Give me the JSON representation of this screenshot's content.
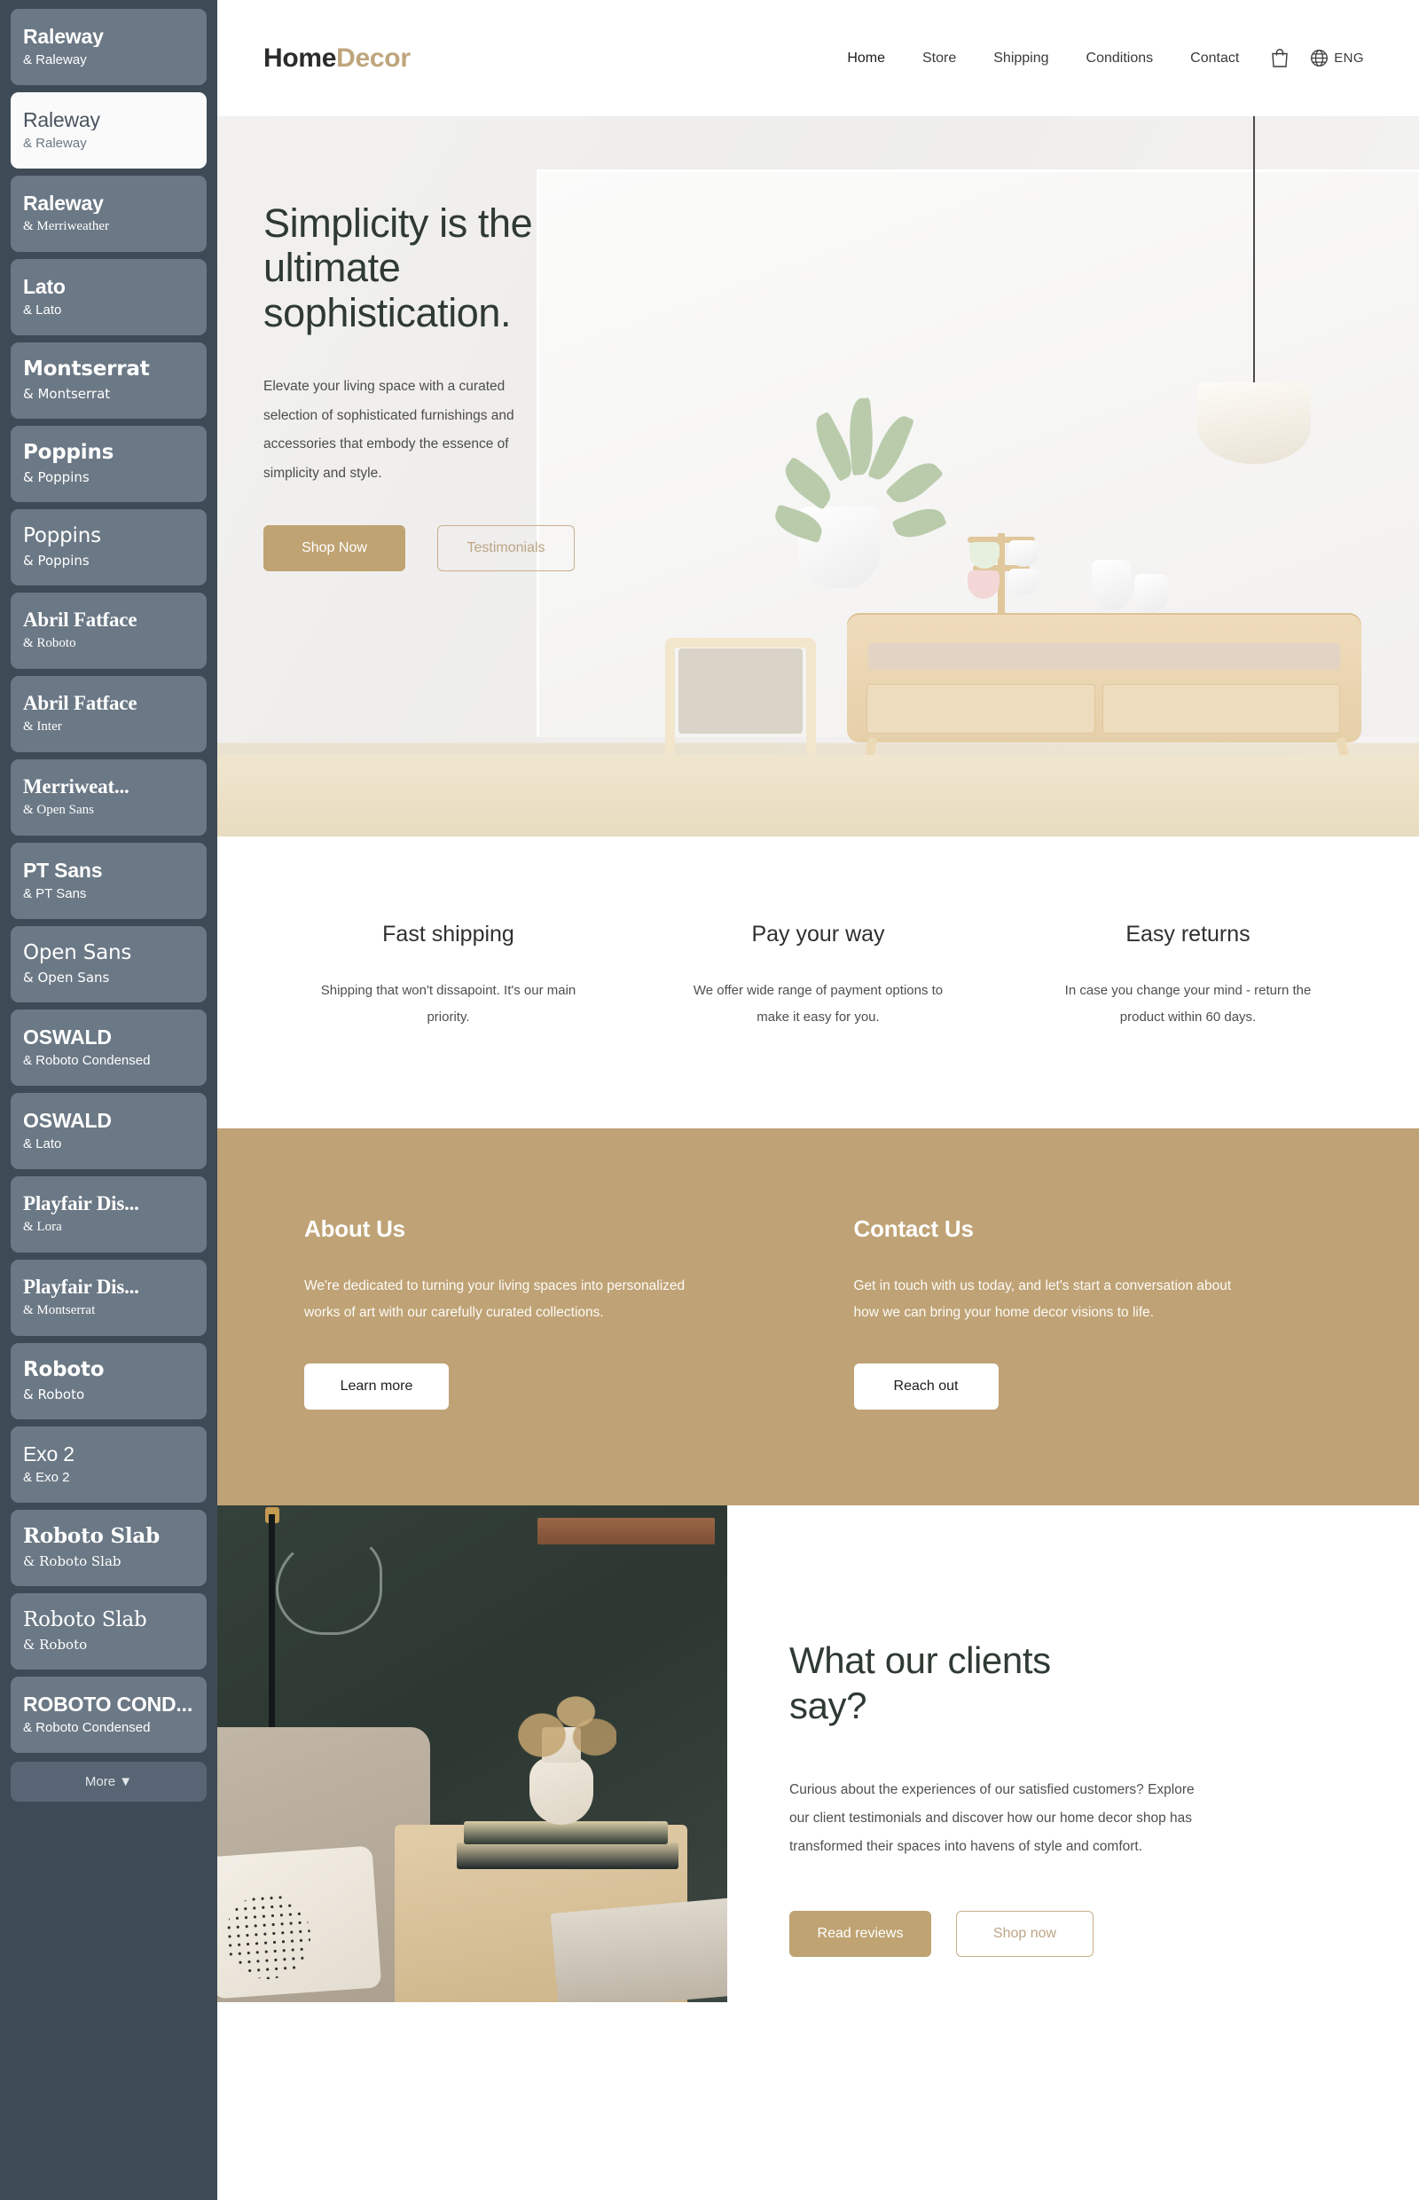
{
  "sidebar": {
    "font_pairs": [
      {
        "title": "Raleway",
        "sub": "& Raleway",
        "style": "f-sans",
        "bold": true,
        "selected": false
      },
      {
        "title": "Raleway",
        "sub": "& Raleway",
        "style": "f-sans",
        "bold": false,
        "selected": true
      },
      {
        "title": "Raleway",
        "sub": "& Merriweather",
        "style": "f-sans",
        "bold": true,
        "selected": false,
        "sub_style": "f-serif"
      },
      {
        "title": "Lato",
        "sub": "& Lato",
        "style": "f-sans",
        "bold": true,
        "selected": false
      },
      {
        "title": "Montserrat",
        "sub": "& Montserrat",
        "style": "f-dejavu",
        "bold": true,
        "selected": false
      },
      {
        "title": "Poppins",
        "sub": "& Poppins",
        "style": "f-dejavu",
        "bold": true,
        "selected": false
      },
      {
        "title": "Poppins",
        "sub": "& Poppins",
        "style": "f-dejavu",
        "bold": false,
        "selected": false
      },
      {
        "title": "Abril Fatface",
        "sub": "& Roboto",
        "style": "f-serif",
        "bold": true,
        "selected": false
      },
      {
        "title": "Abril Fatface",
        "sub": "& Inter",
        "style": "f-serif",
        "bold": true,
        "selected": false
      },
      {
        "title": "Merriweat...",
        "sub": "& Open Sans",
        "style": "f-serif",
        "bold": true,
        "selected": false
      },
      {
        "title": "PT Sans",
        "sub": "& PT Sans",
        "style": "f-sans",
        "bold": true,
        "selected": false
      },
      {
        "title": "Open Sans",
        "sub": "& Open Sans",
        "style": "f-dejavu",
        "bold": false,
        "selected": false
      },
      {
        "title": "OSWALD",
        "sub": "& Roboto Condensed",
        "style": "f-cond",
        "bold": true,
        "selected": false
      },
      {
        "title": "OSWALD",
        "sub": "& Lato",
        "style": "f-cond",
        "bold": true,
        "selected": false
      },
      {
        "title": "Playfair Dis...",
        "sub": "& Lora",
        "style": "f-serif",
        "bold": true,
        "selected": false
      },
      {
        "title": "Playfair Dis...",
        "sub": "& Montserrat",
        "style": "f-serif",
        "bold": true,
        "selected": false
      },
      {
        "title": "Roboto",
        "sub": "& Roboto",
        "style": "f-dejavu",
        "bold": true,
        "selected": false
      },
      {
        "title": "Exo 2",
        "sub": "& Exo 2",
        "style": "f-sans",
        "bold": false,
        "selected": false
      },
      {
        "title": "Roboto Slab",
        "sub": "& Roboto Slab",
        "style": "f-dejavu-s",
        "bold": true,
        "selected": false
      },
      {
        "title": "Roboto Slab",
        "sub": "& Roboto",
        "style": "f-dejavu-s",
        "bold": false,
        "selected": false
      },
      {
        "title": "ROBOTO COND...",
        "sub": "& Roboto Condensed",
        "style": "f-cond",
        "bold": true,
        "selected": false
      }
    ],
    "more_label": "More ▼"
  },
  "header": {
    "logo_part_a": "Home",
    "logo_part_b": "Decor",
    "nav": [
      {
        "label": "Home",
        "active": true
      },
      {
        "label": "Store",
        "active": false
      },
      {
        "label": "Shipping",
        "active": false
      },
      {
        "label": "Conditions",
        "active": false
      },
      {
        "label": "Contact",
        "active": false
      }
    ],
    "cart_icon": "shopping-bag-icon",
    "globe_icon": "globe-icon",
    "language": "ENG"
  },
  "hero": {
    "heading": "Simplicity is the ultimate sophistication.",
    "paragraph": "Elevate your living space with a curated selection of sophisticated furnishings and accessories that embody the essence of simplicity and style.",
    "primary_button": "Shop Now",
    "secondary_button": "Testimonials"
  },
  "features": [
    {
      "title": "Fast shipping",
      "description": "Shipping that won't dissapoint. It's our main priority."
    },
    {
      "title": "Pay your way",
      "description": "We offer wide range of payment options to make it easy for you."
    },
    {
      "title": "Easy returns",
      "description": "In case you change your mind - return the product within 60 days."
    }
  ],
  "about": {
    "title": "About Us",
    "text": "We're dedicated to turning your living spaces into personalized works of art with our carefully curated collections.",
    "button": "Learn more"
  },
  "contact": {
    "title": "Contact Us",
    "text": "Get in touch with us today, and let's start a conversation about how we can bring your home decor visions to life.",
    "button": "Reach out"
  },
  "testimonials": {
    "heading": "What our clients say?",
    "paragraph": "Curious about the experiences of our satisfied customers? Explore our client testimonials and discover how our home decor shop has transformed their spaces into havens of style and comfort.",
    "primary_button": "Read reviews",
    "secondary_button": "Shop now"
  },
  "colors": {
    "accent_tan": "#bfa275",
    "button_tan": "#bfa372",
    "sidebar_bg": "#3e4a56",
    "card_bg": "#6b7885",
    "heading_dark": "#2f3a33"
  }
}
